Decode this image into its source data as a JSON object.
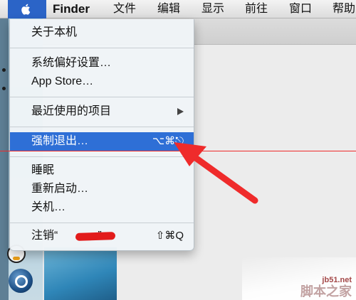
{
  "menubar": {
    "app_name": "Finder",
    "items": [
      {
        "label": "文件"
      },
      {
        "label": "编辑"
      },
      {
        "label": "显示"
      },
      {
        "label": "前往"
      },
      {
        "label": "窗口"
      },
      {
        "label": "帮助"
      }
    ]
  },
  "apple_menu": {
    "about": "关于本机",
    "system_prefs": "系统偏好设置…",
    "app_store": "App Store…",
    "recent_items": "最近使用的项目",
    "force_quit": "强制退出…",
    "force_quit_shortcut": "⌥⌘⎋",
    "sleep": "睡眠",
    "restart": "重新启动…",
    "shutdown": "关机…",
    "logout_prefix": "注销“",
    "logout_suffix": "”…",
    "logout_shortcut": "⇧⌘Q"
  },
  "watermark": {
    "domain": "jb51.net",
    "name": "脚本之家"
  },
  "colors": {
    "highlight": "#2e6fd6",
    "annotation_red": "#ef2b2b"
  }
}
